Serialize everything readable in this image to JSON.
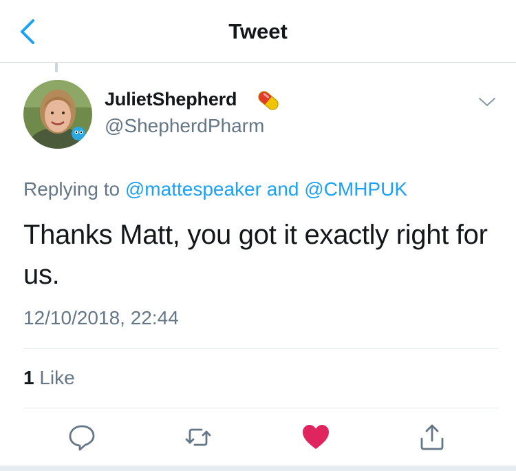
{
  "nav": {
    "title": "Tweet",
    "back_icon": "chevron-left-icon"
  },
  "author": {
    "name": "JulietShepherd",
    "name_emoji": "pill-icon",
    "handle": "@ShepherdPharm"
  },
  "tweet": {
    "replying_prefix": "Replying to",
    "reply_to_1": "@mattespeaker",
    "reply_conjunction": "and",
    "reply_to_2": "@CMHPUK",
    "text": "Thanks Matt, you got it exactly right for us.",
    "timestamp": "12/10/2018, 22:44"
  },
  "stats": {
    "like_count": "1",
    "like_label": "Like"
  },
  "actions": [
    "reply-icon",
    "retweet-icon",
    "heart-icon",
    "share-icon"
  ],
  "colors": {
    "accent": "#1da1f2",
    "like": "#e0245e",
    "secondary_text": "#657786"
  }
}
